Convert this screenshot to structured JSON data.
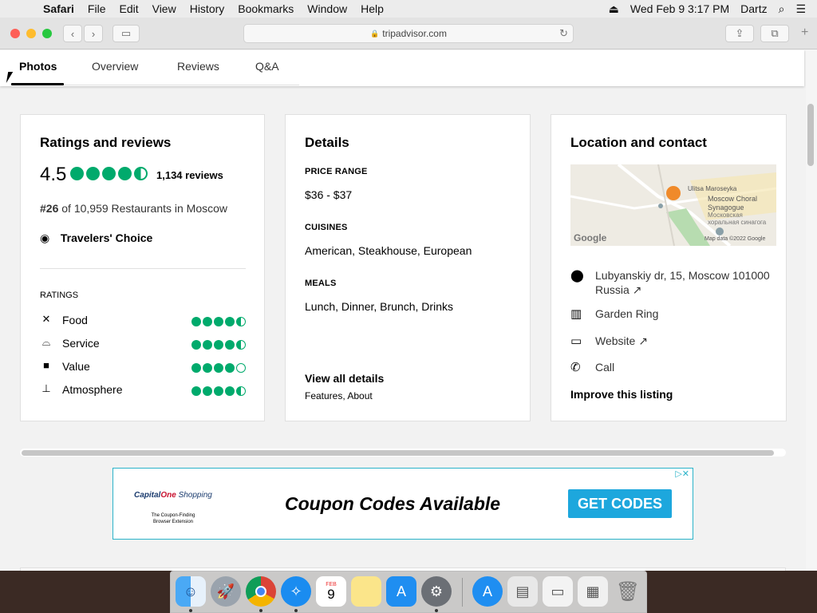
{
  "menubar": {
    "app_name": "Safari",
    "items": [
      "File",
      "Edit",
      "View",
      "History",
      "Bookmarks",
      "Window",
      "Help"
    ],
    "datetime": "Wed Feb 9  3:17 PM",
    "user": "Dartz"
  },
  "browser": {
    "url": "tripadvisor.com"
  },
  "tabs": [
    "Photos",
    "Overview",
    "Reviews",
    "Q&A"
  ],
  "active_tab": "Photos",
  "ratings_card": {
    "title": "Ratings and reviews",
    "score": "4.5",
    "score_bubbles": 4.5,
    "reviews_count": "1,134 reviews",
    "rank_prefix": "#26",
    "rank_rest": "of 10,959 Restaurants in Moscow",
    "award": "Travelers' Choice",
    "ratings_heading": "RATINGS",
    "ratings": [
      {
        "label": "Food",
        "icon": "utensils-icon",
        "value": 4.5
      },
      {
        "label": "Service",
        "icon": "bell-icon",
        "value": 4.5
      },
      {
        "label": "Value",
        "icon": "wallet-icon",
        "value": 4.0
      },
      {
        "label": "Atmosphere",
        "icon": "drink-icon",
        "value": 4.5
      }
    ]
  },
  "details_card": {
    "title": "Details",
    "price_label": "PRICE RANGE",
    "price_value": "$36 - $37",
    "cuisines_label": "CUISINES",
    "cuisines_value": "American, Steakhouse, European",
    "meals_label": "MEALS",
    "meals_value": "Lunch, Dinner, Brunch, Drinks",
    "view_all": "View all details",
    "view_all_sub": "Features, About"
  },
  "location_card": {
    "title": "Location and contact",
    "map": {
      "street_label": "Ulitsa Maroseyka",
      "poi_label_1": "Moscow Choral",
      "poi_label_2": "Synagogue",
      "poi_label_3": "Московская",
      "poi_label_4": "хоральная синагога",
      "google": "Google",
      "attribution": "Map data ©2022 Google"
    },
    "address_line1": "Lubyanskiy dr, 15, Moscow 101000",
    "address_line2": "Russia ↗",
    "neighborhood": "Garden Ring",
    "website": "Website ↗",
    "call": "Call",
    "improve": "Improve this listing"
  },
  "ad": {
    "brand_capital": "Capital",
    "brand_one": "One",
    "brand_shopping": " Shopping",
    "tagline_1": "The Coupon-Finding",
    "tagline_2": "Browser Extension",
    "headline": "Coupon Codes Available",
    "cta": "GET CODES"
  },
  "dock": {
    "apps": [
      "finder-icon",
      "launchpad-icon",
      "chrome-icon",
      "safari-icon",
      "calendar-icon",
      "notes-icon",
      "app-store-icon",
      "system-preferences-icon",
      "downloads-icon",
      "documents-icon",
      "screenshot-icon",
      "screenshot-stack-icon",
      "trash-icon"
    ],
    "calendar_month": "FEB",
    "calendar_day": "9"
  }
}
